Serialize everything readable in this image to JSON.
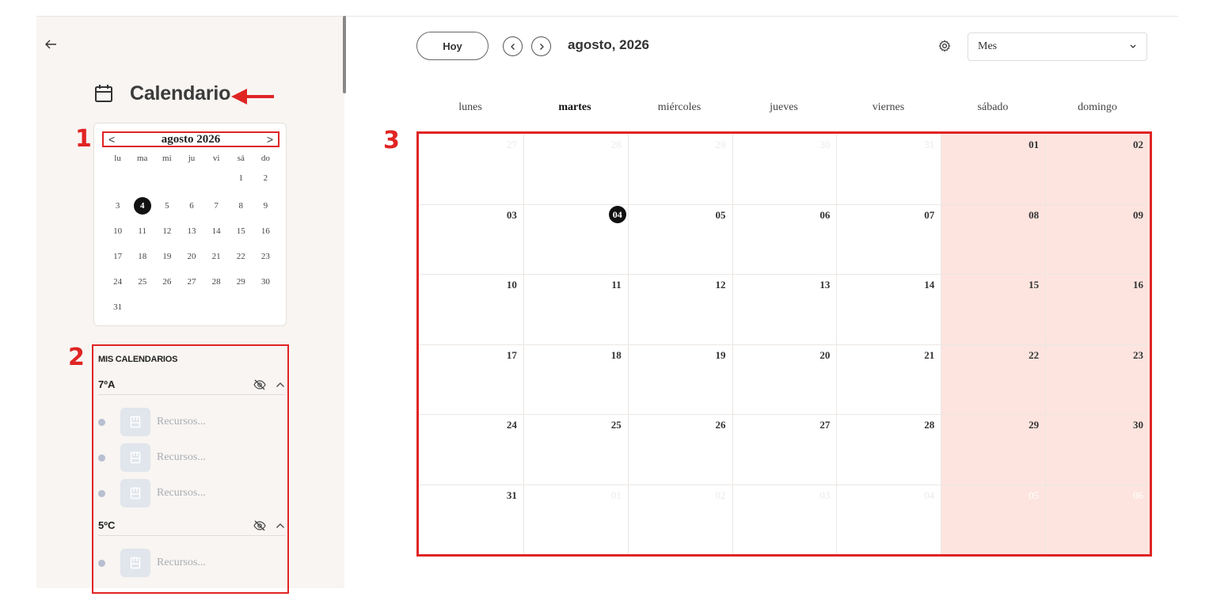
{
  "sidebar": {
    "title": "Calendario",
    "annotation_numbers": [
      "1",
      "2",
      "3"
    ],
    "mini_calendar": {
      "month": "agosto 2026",
      "prev": "<",
      "next": ">",
      "weekdays": [
        "lu",
        "ma",
        "mi",
        "ju",
        "vi",
        "sá",
        "do"
      ],
      "weeks": [
        [
          "",
          "",
          "",
          "",
          "",
          "1",
          "2"
        ],
        [
          "3",
          "4",
          "5",
          "6",
          "7",
          "8",
          "9"
        ],
        [
          "10",
          "11",
          "12",
          "13",
          "14",
          "15",
          "16"
        ],
        [
          "17",
          "18",
          "19",
          "20",
          "21",
          "22",
          "23"
        ],
        [
          "24",
          "25",
          "26",
          "27",
          "28",
          "29",
          "30"
        ],
        [
          "31",
          "",
          "",
          "",
          "",
          "",
          ""
        ]
      ],
      "today": "4"
    },
    "my_calendars": {
      "title": "MIS CALENDARIOS",
      "groups": [
        {
          "name": "7ºA",
          "resources": [
            "Recursos...",
            "Recursos...",
            "Recursos..."
          ]
        },
        {
          "name": "5ºC",
          "resources": [
            "Recursos..."
          ]
        }
      ]
    }
  },
  "toolbar": {
    "today_label": "Hoy",
    "month_label": "agosto, 2026",
    "view_selected": "Mes"
  },
  "calendar": {
    "weekdays": [
      "lunes",
      "martes",
      "miércoles",
      "jueves",
      "viernes",
      "sábado",
      "domingo"
    ],
    "current_weekday_index": 1,
    "weeks": [
      [
        {
          "d": "27",
          "o": true
        },
        {
          "d": "28",
          "o": true
        },
        {
          "d": "29",
          "o": true
        },
        {
          "d": "30",
          "o": true
        },
        {
          "d": "31",
          "o": true
        },
        {
          "d": "01"
        },
        {
          "d": "02"
        }
      ],
      [
        {
          "d": "03"
        },
        {
          "d": "04",
          "t": true
        },
        {
          "d": "05"
        },
        {
          "d": "06"
        },
        {
          "d": "07"
        },
        {
          "d": "08"
        },
        {
          "d": "09"
        }
      ],
      [
        {
          "d": "10"
        },
        {
          "d": "11"
        },
        {
          "d": "12"
        },
        {
          "d": "13"
        },
        {
          "d": "14"
        },
        {
          "d": "15"
        },
        {
          "d": "16"
        }
      ],
      [
        {
          "d": "17"
        },
        {
          "d": "18"
        },
        {
          "d": "19"
        },
        {
          "d": "20"
        },
        {
          "d": "21"
        },
        {
          "d": "22"
        },
        {
          "d": "23"
        }
      ],
      [
        {
          "d": "24"
        },
        {
          "d": "25"
        },
        {
          "d": "26"
        },
        {
          "d": "27"
        },
        {
          "d": "28"
        },
        {
          "d": "29"
        },
        {
          "d": "30"
        }
      ],
      [
        {
          "d": "31"
        },
        {
          "d": "01",
          "o": true
        },
        {
          "d": "02",
          "o": true
        },
        {
          "d": "03",
          "o": true
        },
        {
          "d": "04",
          "o": true
        },
        {
          "d": "05",
          "o": true
        },
        {
          "d": "06",
          "o": true
        }
      ]
    ]
  },
  "colors": {
    "annotation_red": "#e02424",
    "weekend_bg": "#fde4df",
    "today_bg": "#111111"
  },
  "icons": [
    "back-arrow-icon",
    "calendar-icon",
    "chevron-left-icon",
    "chevron-right-icon",
    "settings-icon",
    "chevron-down-icon",
    "eye-off-icon",
    "chevron-up-icon",
    "resource-icon"
  ]
}
